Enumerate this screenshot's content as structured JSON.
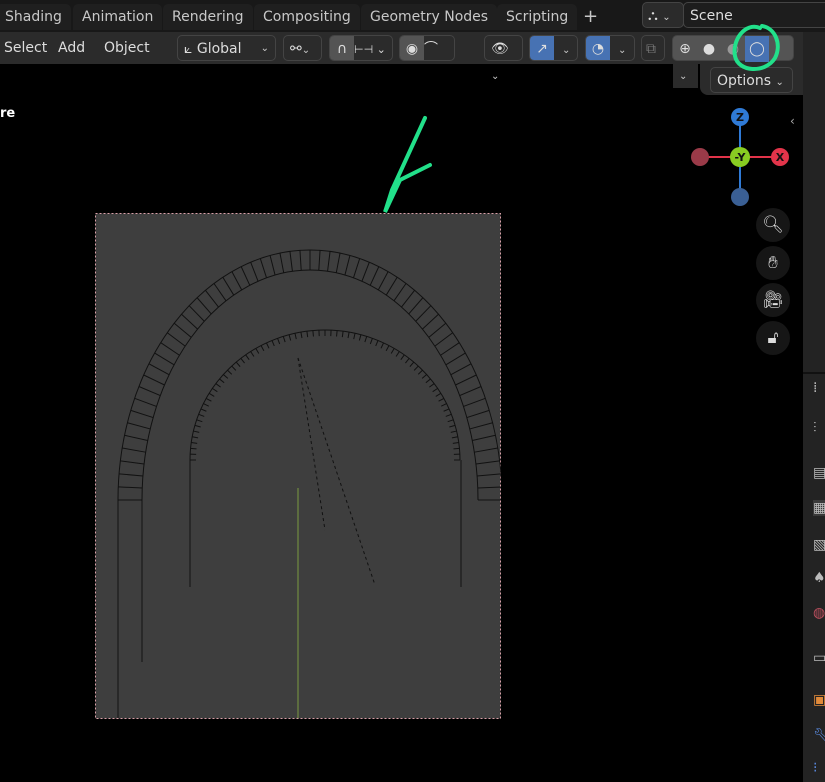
{
  "workspace_tabs": [
    "Shading",
    "Animation",
    "Rendering",
    "Compositing",
    "Geometry Nodes",
    "Scripting"
  ],
  "add_tab_label": "+",
  "scene": {
    "name": "Scene",
    "icon": "scene-icon"
  },
  "header": {
    "menus": [
      "Select",
      "Add",
      "Object"
    ],
    "transform_orientation": "Global",
    "options_label": "Options"
  },
  "viewport": {
    "overlay_text": "re",
    "gizmo": {
      "z": "Z",
      "y": "-Y",
      "x": "X"
    }
  },
  "colors": {
    "accent": "#4772b3",
    "annotation": "#22e08a",
    "x_axis": "#e2344a",
    "y_axis": "#88cc22",
    "z_axis": "#2f7ad6"
  },
  "shading_mode_active": "rendered"
}
